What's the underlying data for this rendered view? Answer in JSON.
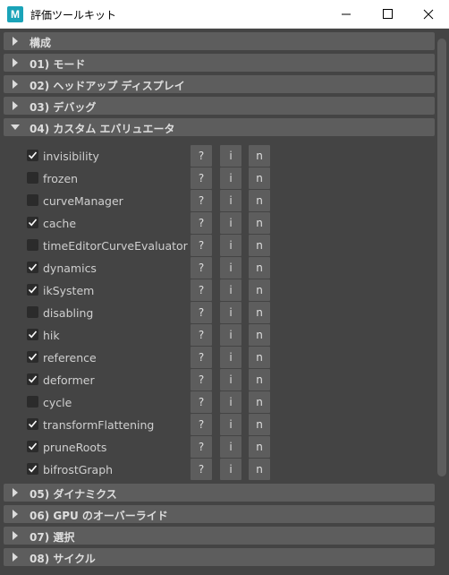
{
  "window": {
    "title": "評価ツールキット",
    "app_icon": "maya-icon",
    "controls": [
      "minimize-icon",
      "maximize-icon",
      "close-icon"
    ]
  },
  "sections_top": [
    {
      "label": "構成",
      "expanded": false
    },
    {
      "label": "01) モード",
      "expanded": false
    },
    {
      "label": "02) ヘッドアップ ディスプレイ",
      "expanded": false
    },
    {
      "label": "03) デバッグ",
      "expanded": false
    },
    {
      "label": "04) カスタム エバリュエータ",
      "expanded": true
    }
  ],
  "evaluators": [
    {
      "name": "invisibility",
      "checked": true
    },
    {
      "name": "frozen",
      "checked": false
    },
    {
      "name": "curveManager",
      "checked": false
    },
    {
      "name": "cache",
      "checked": true
    },
    {
      "name": "timeEditorCurveEvaluator",
      "checked": false
    },
    {
      "name": "dynamics",
      "checked": true
    },
    {
      "name": "ikSystem",
      "checked": true
    },
    {
      "name": "disabling",
      "checked": false
    },
    {
      "name": "hik",
      "checked": true
    },
    {
      "name": "reference",
      "checked": true
    },
    {
      "name": "deformer",
      "checked": true
    },
    {
      "name": "cycle",
      "checked": false
    },
    {
      "name": "transformFlattening",
      "checked": true
    },
    {
      "name": "pruneRoots",
      "checked": true
    },
    {
      "name": "bifrostGraph",
      "checked": true
    }
  ],
  "row_buttons": {
    "help": "?",
    "info": "i",
    "node": "n"
  },
  "sections_bottom": [
    {
      "label": "05) ダイナミクス",
      "expanded": false
    },
    {
      "label": "06) GPU のオーバーライド",
      "expanded": false
    },
    {
      "label": "07) 選択",
      "expanded": false
    },
    {
      "label": "08) サイクル",
      "expanded": false
    }
  ],
  "colors": {
    "background": "#444444",
    "header": "#5d5d5d",
    "button": "#5d5d5d",
    "checkbox": "#2b2b2b",
    "text": "#cfcfcf"
  }
}
